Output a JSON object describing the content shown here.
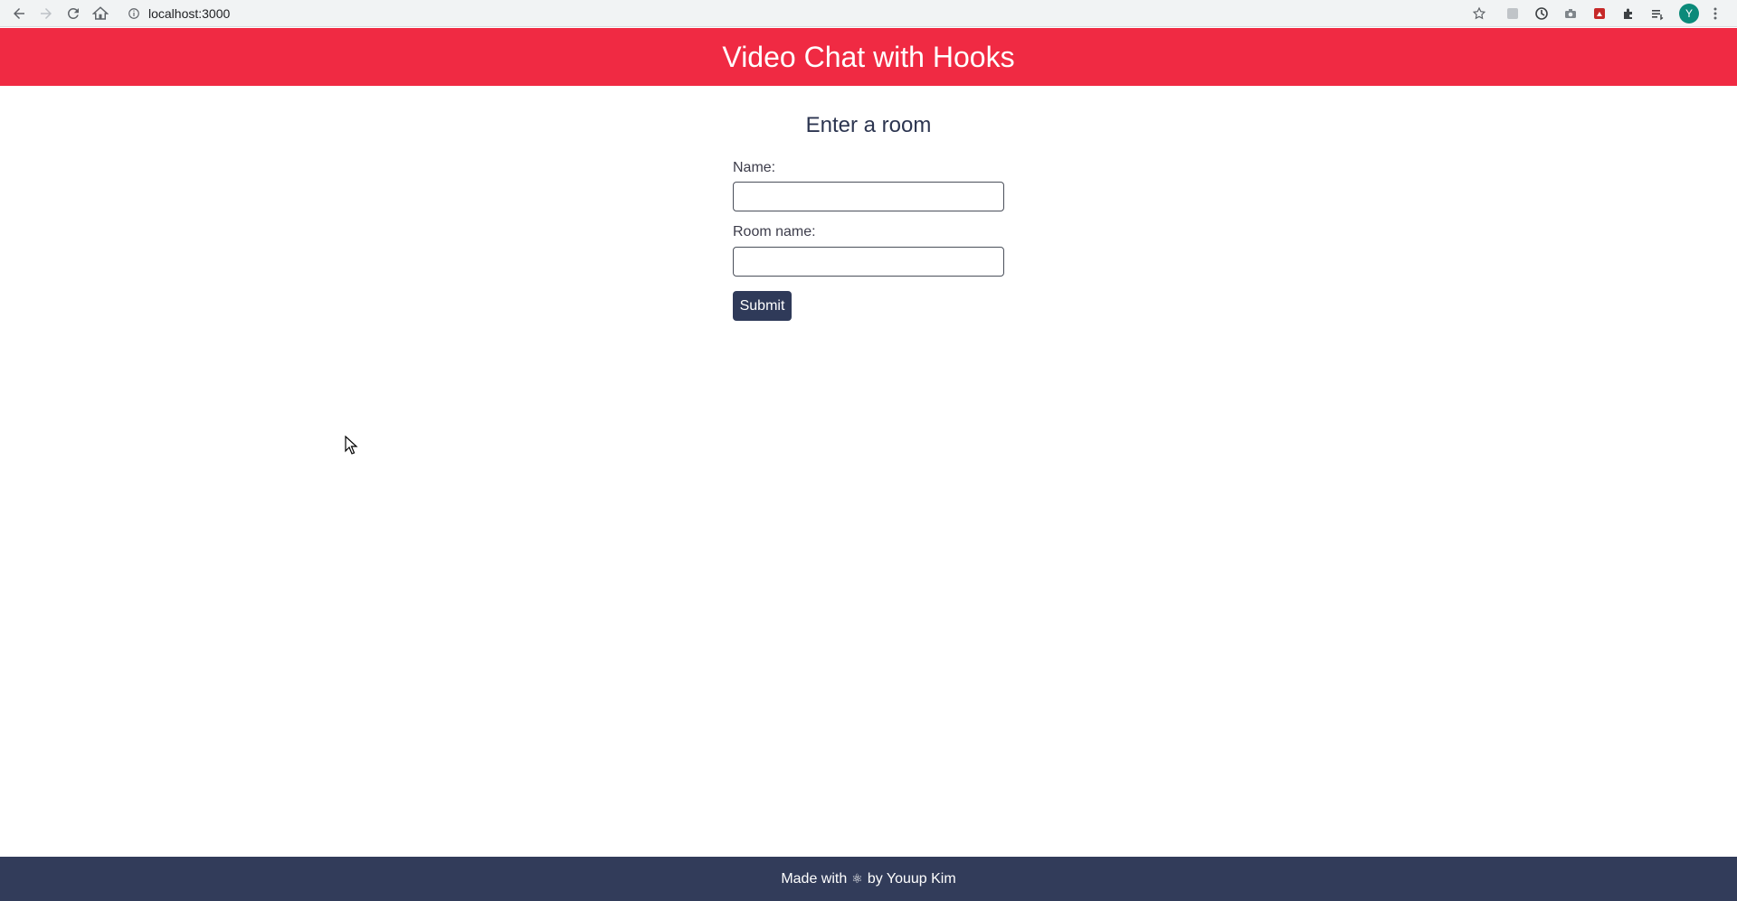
{
  "browser": {
    "url": "localhost:3000",
    "avatar_letter": "Y",
    "avatar_color": "#0b8a7a",
    "extensions": [
      "extension-icon",
      "history-icon",
      "camera-icon",
      "screenshot-icon",
      "puzzle-icon",
      "reading-list-icon"
    ]
  },
  "header": {
    "title": "Video Chat with Hooks",
    "color": "#f02a43"
  },
  "form": {
    "title": "Enter a room",
    "name_label": "Name:",
    "name_value": "",
    "room_label": "Room name:",
    "room_value": "",
    "submit_label": "Submit",
    "button_color": "#2f3a59"
  },
  "footer": {
    "prefix": "Made with",
    "icon": "⚛",
    "suffix": "by Youup Kim",
    "color": "#323c5a"
  }
}
